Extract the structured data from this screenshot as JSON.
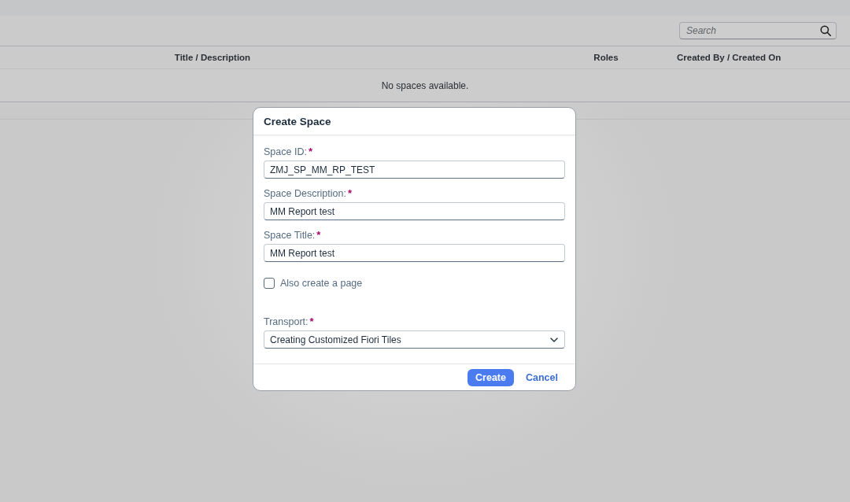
{
  "toolbar": {
    "search": {
      "placeholder": "Search"
    }
  },
  "table": {
    "columns": [
      "Title / Description",
      "Roles",
      "Created By / Created On"
    ],
    "empty_text": "No spaces available."
  },
  "dialog": {
    "title": "Create Space",
    "fields": [
      {
        "label": "Space ID:",
        "required_mark": "*",
        "value": "ZMJ_SP_MM_RP_TEST"
      },
      {
        "label": "Space Description:",
        "required_mark": "*",
        "value": "MM Report test"
      },
      {
        "label": "Space Title:",
        "required_mark": "*",
        "value": "MM Report test"
      }
    ],
    "checkbox": {
      "label": "Also create a page",
      "checked": false
    },
    "transport": {
      "label": "Transport:",
      "required_mark": "*",
      "value": "Creating Customized Fiori Tiles"
    },
    "buttons": [
      {
        "label": "Create",
        "kind": "primary"
      },
      {
        "label": "Cancel",
        "kind": "transparent"
      }
    ]
  }
}
